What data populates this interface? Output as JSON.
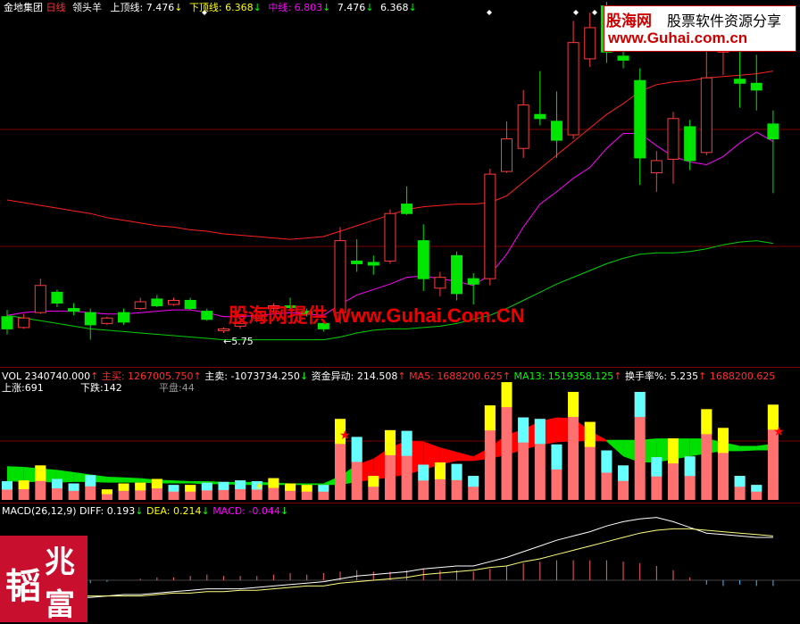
{
  "main_header": {
    "stock": "金地集团",
    "period": "日线",
    "indicator": "领头羊",
    "upper_label": "上顶线:",
    "upper_value": "7.476",
    "lower_label": "下顶线:",
    "lower_value": "6.368",
    "mid_label": "中线:",
    "mid_value": "6.803",
    "extra1": "7.476",
    "extra2": "6.368"
  },
  "low_price_label": "←5.75",
  "vol_header": {
    "vol": "VOL 2340740.000",
    "buy_label": "主买:",
    "buy_value": "1267005.750",
    "sell_label": "主卖:",
    "sell_value": "-1073734.250",
    "flow_label": "资金异动:",
    "flow_value": "214.508",
    "ma5_label": "MA5:",
    "ma5_value": "1688200.625",
    "ma13_label": "MA13:",
    "ma13_value": "1519358.125",
    "turnover_label": "换手率%:",
    "turnover_value": "5.235",
    "tail_value": "1688200.625"
  },
  "breadth": {
    "up": "上涨:691",
    "down": "下跌:142",
    "flat": "平盘:44"
  },
  "macd_header": {
    "name": "MACD(26,12,9)",
    "diff_label": "DIFF:",
    "diff_value": "0.193",
    "dea_label": "DEA:",
    "dea_value": "0.214",
    "macd_label": "MACD:",
    "macd_value": "-0.044"
  },
  "watermark_top": {
    "brand": "股海网",
    "slogan": "股票软件资源分享",
    "url": "www.Guhai.com.cn"
  },
  "watermark_mid": "股海网提供 Www.Guhai.Com.CN",
  "seal_text": [
    "兆",
    "富",
    "韬"
  ],
  "colors": {
    "up": "#ff3c3c",
    "down": "#00e600",
    "white": "#ffffff",
    "yellow": "#ffff00",
    "magenta": "#ff00ff",
    "green": "#00d000",
    "cyan": "#66ffff",
    "pinkbar": "#ff7070",
    "grid": "#800000"
  },
  "chart_data": {
    "type": "candlestick",
    "title": "金地集团 日线 领头羊",
    "indicator_values": {
      "上顶线": 7.476,
      "下顶线": 6.368,
      "中线": 6.803
    },
    "min_label": 5.75,
    "candles": [
      {
        "o": 5.89,
        "c": 5.8,
        "h": 5.94,
        "l": 5.76
      },
      {
        "o": 5.81,
        "c": 5.88,
        "h": 5.91,
        "l": 5.8
      },
      {
        "o": 5.92,
        "c": 6.12,
        "h": 6.17,
        "l": 5.91
      },
      {
        "o": 6.07,
        "c": 5.99,
        "h": 6.09,
        "l": 5.96
      },
      {
        "o": 5.95,
        "c": 5.93,
        "h": 5.99,
        "l": 5.9
      },
      {
        "o": 5.92,
        "c": 5.83,
        "h": 5.95,
        "l": 5.72
      },
      {
        "o": 5.84,
        "c": 5.88,
        "h": 5.89,
        "l": 5.83
      },
      {
        "o": 5.92,
        "c": 5.85,
        "h": 5.95,
        "l": 5.83
      },
      {
        "o": 5.95,
        "c": 6.0,
        "h": 6.03,
        "l": 5.94
      },
      {
        "o": 6.02,
        "c": 5.97,
        "h": 6.05,
        "l": 5.96
      },
      {
        "o": 5.98,
        "c": 6.01,
        "h": 6.03,
        "l": 5.97
      },
      {
        "o": 6.01,
        "c": 5.95,
        "h": 6.03,
        "l": 5.94
      },
      {
        "o": 5.93,
        "c": 5.87,
        "h": 5.95,
        "l": 5.86
      },
      {
        "o": 5.79,
        "c": 5.8,
        "h": 5.81,
        "l": 5.77
      },
      {
        "o": 5.82,
        "c": 5.84,
        "h": 5.85,
        "l": 5.8
      },
      {
        "o": 5.88,
        "c": 5.9,
        "h": 5.95,
        "l": 5.85
      },
      {
        "o": 5.95,
        "c": 5.97,
        "h": 5.99,
        "l": 5.92
      },
      {
        "o": 5.97,
        "c": 5.96,
        "h": 6.03,
        "l": 5.94
      },
      {
        "o": 5.93,
        "c": 5.91,
        "h": 5.95,
        "l": 5.89
      },
      {
        "o": 5.84,
        "c": 5.8,
        "h": 5.86,
        "l": 5.78
      },
      {
        "o": 5.92,
        "c": 6.45,
        "h": 6.55,
        "l": 5.84
      },
      {
        "o": 6.3,
        "c": 6.28,
        "h": 6.46,
        "l": 6.22
      },
      {
        "o": 6.29,
        "c": 6.27,
        "h": 6.34,
        "l": 6.2
      },
      {
        "o": 6.3,
        "c": 6.65,
        "h": 6.68,
        "l": 6.28
      },
      {
        "o": 6.72,
        "c": 6.65,
        "h": 6.85,
        "l": 6.64
      },
      {
        "o": 6.45,
        "c": 6.17,
        "h": 6.57,
        "l": 6.08
      },
      {
        "o": 6.1,
        "c": 6.18,
        "h": 6.22,
        "l": 6.04
      },
      {
        "o": 6.34,
        "c": 6.06,
        "h": 6.37,
        "l": 6.01
      },
      {
        "o": 6.17,
        "c": 6.13,
        "h": 6.21,
        "l": 5.98
      },
      {
        "o": 6.17,
        "c": 6.94,
        "h": 6.98,
        "l": 6.12
      },
      {
        "o": 6.96,
        "c": 7.2,
        "h": 7.33,
        "l": 6.95
      },
      {
        "o": 7.13,
        "c": 7.45,
        "h": 7.56,
        "l": 7.06
      },
      {
        "o": 7.38,
        "c": 7.35,
        "h": 7.7,
        "l": 7.3
      },
      {
        "o": 7.33,
        "c": 7.19,
        "h": 7.55,
        "l": 7.06
      },
      {
        "o": 7.23,
        "c": 7.91,
        "h": 8.07,
        "l": 7.2
      },
      {
        "o": 7.79,
        "c": 8.02,
        "h": 8.13,
        "l": 7.73
      },
      {
        "o": 8.18,
        "c": 7.84,
        "h": 8.21,
        "l": 7.76
      },
      {
        "o": 7.81,
        "c": 7.78,
        "h": 7.92,
        "l": 7.72
      },
      {
        "o": 7.63,
        "c": 7.06,
        "h": 7.72,
        "l": 6.86
      },
      {
        "o": 6.95,
        "c": 7.04,
        "h": 7.11,
        "l": 6.81
      },
      {
        "o": 7.05,
        "c": 7.35,
        "h": 7.4,
        "l": 6.87
      },
      {
        "o": 7.29,
        "c": 7.04,
        "h": 7.34,
        "l": 6.97
      },
      {
        "o": 7.1,
        "c": 7.65,
        "h": 7.97,
        "l": 7.08
      },
      {
        "o": 7.84,
        "c": 7.92,
        "h": 8.03,
        "l": 7.67
      },
      {
        "o": 7.64,
        "c": 7.61,
        "h": 7.85,
        "l": 7.43
      },
      {
        "o": 7.61,
        "c": 7.56,
        "h": 7.82,
        "l": 7.41
      },
      {
        "o": 7.31,
        "c": 7.2,
        "h": 7.41,
        "l": 6.8
      }
    ],
    "upper_line": [
      6.75,
      6.73,
      6.71,
      6.69,
      6.67,
      6.65,
      6.62,
      6.6,
      6.58,
      6.56,
      6.55,
      6.53,
      6.52,
      6.5,
      6.49,
      6.48,
      6.47,
      6.46,
      6.47,
      6.48,
      6.52,
      6.56,
      6.6,
      6.64,
      6.68,
      6.7,
      6.71,
      6.72,
      6.72,
      6.73,
      6.78,
      6.88,
      6.98,
      7.08,
      7.18,
      7.28,
      7.38,
      7.46,
      7.55,
      7.6,
      7.62,
      7.63,
      7.65,
      7.66,
      7.67,
      7.68,
      7.7
    ],
    "lower_line": [
      5.9,
      5.88,
      5.86,
      5.84,
      5.82,
      5.8,
      5.79,
      5.78,
      5.77,
      5.76,
      5.75,
      5.74,
      5.73,
      5.72,
      5.72,
      5.72,
      5.72,
      5.72,
      5.72,
      5.72,
      5.74,
      5.77,
      5.79,
      5.8,
      5.8,
      5.81,
      5.82,
      5.84,
      5.87,
      5.9,
      5.95,
      6.01,
      6.07,
      6.13,
      6.18,
      6.23,
      6.28,
      6.32,
      6.35,
      6.36,
      6.36,
      6.37,
      6.39,
      6.42,
      6.44,
      6.45,
      6.43
    ],
    "mid_line": [
      5.9,
      5.92,
      5.93,
      5.93,
      5.93,
      5.92,
      5.91,
      5.91,
      5.92,
      5.93,
      5.94,
      5.94,
      5.92,
      5.89,
      5.89,
      5.9,
      5.91,
      5.92,
      5.91,
      5.9,
      5.98,
      6.05,
      6.09,
      6.13,
      6.18,
      6.19,
      6.17,
      6.15,
      6.12,
      6.2,
      6.35,
      6.55,
      6.72,
      6.81,
      6.91,
      6.99,
      7.13,
      7.24,
      7.24,
      7.15,
      7.07,
      7.03,
      7.01,
      7.07,
      7.17,
      7.25,
      7.18
    ],
    "volume": [
      {
        "v": 0.25,
        "up": false
      },
      {
        "v": 0.26,
        "up": true
      },
      {
        "v": 0.46,
        "up": true
      },
      {
        "v": 0.28,
        "up": false
      },
      {
        "v": 0.22,
        "up": false
      },
      {
        "v": 0.33,
        "up": false
      },
      {
        "v": 0.14,
        "up": true
      },
      {
        "v": 0.22,
        "up": true
      },
      {
        "v": 0.23,
        "up": true
      },
      {
        "v": 0.28,
        "up": true
      },
      {
        "v": 0.2,
        "up": false
      },
      {
        "v": 0.2,
        "up": true
      },
      {
        "v": 0.23,
        "up": false
      },
      {
        "v": 0.24,
        "up": false
      },
      {
        "v": 0.26,
        "up": false
      },
      {
        "v": 0.25,
        "up": false
      },
      {
        "v": 0.29,
        "up": true
      },
      {
        "v": 0.22,
        "up": true
      },
      {
        "v": 0.2,
        "up": true
      },
      {
        "v": 0.2,
        "up": false
      },
      {
        "v": 1.08,
        "up": true
      },
      {
        "v": 0.84,
        "up": false
      },
      {
        "v": 0.32,
        "up": true
      },
      {
        "v": 0.93,
        "up": true
      },
      {
        "v": 0.92,
        "up": false
      },
      {
        "v": 0.47,
        "up": false
      },
      {
        "v": 0.5,
        "up": true
      },
      {
        "v": 0.48,
        "up": false
      },
      {
        "v": 0.32,
        "up": false
      },
      {
        "v": 1.26,
        "up": true
      },
      {
        "v": 1.57,
        "up": true
      },
      {
        "v": 1.1,
        "up": false
      },
      {
        "v": 1.08,
        "up": false
      },
      {
        "v": 0.74,
        "up": false
      },
      {
        "v": 1.44,
        "up": true
      },
      {
        "v": 1.04,
        "up": true
      },
      {
        "v": 0.66,
        "up": false
      },
      {
        "v": 0.46,
        "up": false
      },
      {
        "v": 1.44,
        "up": false
      },
      {
        "v": 0.57,
        "up": false
      },
      {
        "v": 0.82,
        "up": true
      },
      {
        "v": 0.58,
        "up": false
      },
      {
        "v": 1.21,
        "up": true
      },
      {
        "v": 0.96,
        "up": true
      },
      {
        "v": 0.32,
        "up": false
      },
      {
        "v": 0.2,
        "up": false
      },
      {
        "v": 1.27,
        "up": true
      }
    ],
    "flow_fill": [
      {
        "t": 0.45,
        "b": 0.25,
        "red": false
      },
      {
        "t": 0.44,
        "b": 0.24,
        "red": false
      },
      {
        "t": 0.42,
        "b": 0.24,
        "red": false
      },
      {
        "t": 0.4,
        "b": 0.23,
        "red": false
      },
      {
        "t": 0.37,
        "b": 0.24,
        "red": false
      },
      {
        "t": 0.34,
        "b": 0.24,
        "red": false
      },
      {
        "t": 0.31,
        "b": 0.23,
        "red": false
      },
      {
        "t": 0.3,
        "b": 0.23,
        "red": false
      },
      {
        "t": 0.29,
        "b": 0.23,
        "red": false
      },
      {
        "t": 0.27,
        "b": 0.22,
        "red": false
      },
      {
        "t": 0.26,
        "b": 0.22,
        "red": false
      },
      {
        "t": 0.25,
        "b": 0.22,
        "red": false
      },
      {
        "t": 0.25,
        "b": 0.21,
        "red": false
      },
      {
        "t": 0.24,
        "b": 0.21,
        "red": false
      },
      {
        "t": 0.24,
        "b": 0.2,
        "red": false
      },
      {
        "t": 0.24,
        "b": 0.2,
        "red": false
      },
      {
        "t": 0.23,
        "b": 0.2,
        "red": false
      },
      {
        "t": 0.22,
        "b": 0.2,
        "red": false
      },
      {
        "t": 0.22,
        "b": 0.2,
        "red": false
      },
      {
        "t": 0.22,
        "b": 0.2,
        "red": false
      },
      {
        "t": 0.32,
        "b": 0.2,
        "red": false
      },
      {
        "t": 0.47,
        "b": 0.24,
        "red": true
      },
      {
        "t": 0.55,
        "b": 0.27,
        "red": true
      },
      {
        "t": 0.7,
        "b": 0.3,
        "red": true
      },
      {
        "t": 0.79,
        "b": 0.34,
        "red": true
      },
      {
        "t": 0.78,
        "b": 0.4,
        "red": true
      },
      {
        "t": 0.7,
        "b": 0.47,
        "red": true
      },
      {
        "t": 0.64,
        "b": 0.52,
        "red": true
      },
      {
        "t": 0.58,
        "b": 0.52,
        "red": true
      },
      {
        "t": 0.7,
        "b": 0.55,
        "red": true
      },
      {
        "t": 0.87,
        "b": 0.6,
        "red": true
      },
      {
        "t": 0.94,
        "b": 0.67,
        "red": true
      },
      {
        "t": 1.05,
        "b": 0.73,
        "red": true
      },
      {
        "t": 1.1,
        "b": 0.77,
        "red": true
      },
      {
        "t": 1.09,
        "b": 0.78,
        "red": true
      },
      {
        "t": 0.92,
        "b": 0.79,
        "red": true
      },
      {
        "t": 0.8,
        "b": 0.78,
        "red": false
      },
      {
        "t": 0.8,
        "b": 0.58,
        "red": false
      },
      {
        "t": 0.8,
        "b": 0.5,
        "red": false
      },
      {
        "t": 0.82,
        "b": 0.5,
        "red": false
      },
      {
        "t": 0.82,
        "b": 0.54,
        "red": false
      },
      {
        "t": 0.82,
        "b": 0.58,
        "red": false
      },
      {
        "t": 0.82,
        "b": 0.62,
        "red": false
      },
      {
        "t": 0.77,
        "b": 0.65,
        "red": false
      },
      {
        "t": 0.72,
        "b": 0.65,
        "red": false
      },
      {
        "t": 0.72,
        "b": 0.66,
        "red": false
      },
      {
        "t": 0.75,
        "b": 0.66,
        "red": false
      }
    ],
    "macd_diff": [
      -0.1,
      -0.12,
      -0.12,
      -0.11,
      -0.12,
      -0.12,
      -0.11,
      -0.1,
      -0.1,
      -0.09,
      -0.08,
      -0.07,
      -0.06,
      -0.06,
      -0.06,
      -0.05,
      -0.04,
      -0.03,
      -0.02,
      -0.01,
      0.01,
      0.03,
      0.04,
      0.05,
      0.06,
      0.08,
      0.09,
      0.1,
      0.1,
      0.13,
      0.16,
      0.2,
      0.24,
      0.28,
      0.31,
      0.34,
      0.38,
      0.41,
      0.43,
      0.44,
      0.41,
      0.37,
      0.33,
      0.32,
      0.31,
      0.3,
      0.3
    ],
    "macd_dea": [
      -0.11,
      -0.11,
      -0.11,
      -0.11,
      -0.11,
      -0.11,
      -0.11,
      -0.11,
      -0.11,
      -0.1,
      -0.09,
      -0.09,
      -0.08,
      -0.08,
      -0.07,
      -0.07,
      -0.06,
      -0.05,
      -0.04,
      -0.04,
      -0.02,
      -0.01,
      0.0,
      0.01,
      0.02,
      0.04,
      0.05,
      0.06,
      0.07,
      0.09,
      0.1,
      0.13,
      0.15,
      0.18,
      0.21,
      0.24,
      0.27,
      0.3,
      0.33,
      0.35,
      0.36,
      0.36,
      0.35,
      0.34,
      0.33,
      0.32,
      0.31
    ],
    "macd_hist": [
      0.01,
      -0.01,
      -0.02,
      -0.01,
      -0.02,
      -0.02,
      -0.01,
      0.0,
      0.01,
      0.02,
      0.02,
      0.03,
      0.04,
      0.03,
      0.03,
      0.03,
      0.04,
      0.05,
      0.04,
      0.05,
      0.06,
      0.07,
      0.06,
      0.06,
      0.07,
      0.08,
      0.07,
      0.07,
      0.06,
      0.08,
      0.1,
      0.12,
      0.13,
      0.14,
      0.14,
      0.14,
      0.14,
      0.13,
      0.12,
      0.1,
      0.07,
      0.02,
      -0.03,
      -0.04,
      -0.03,
      -0.04,
      -0.04
    ]
  }
}
